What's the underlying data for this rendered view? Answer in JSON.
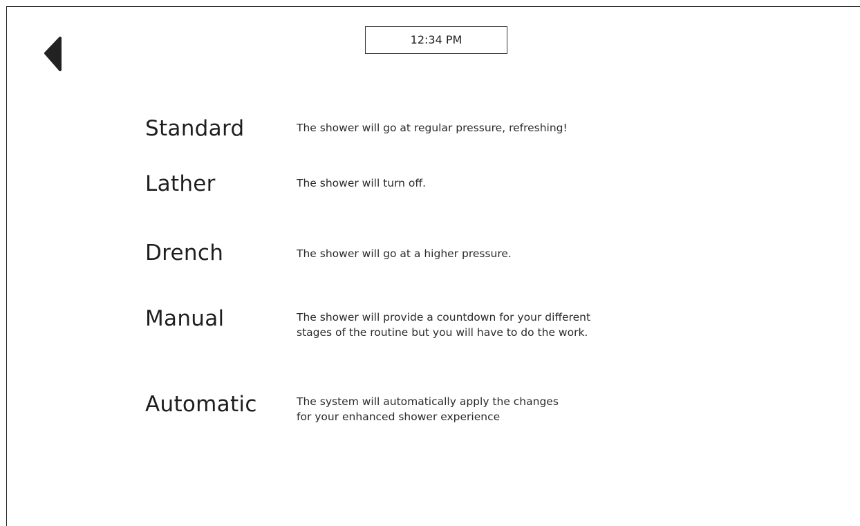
{
  "header": {
    "back_icon": "back-arrow-triangle",
    "time": "12:34 PM"
  },
  "modes": [
    {
      "name": "Standard",
      "description": "The shower will go at regular pressure, refreshing!"
    },
    {
      "name": "Lather",
      "description": "The shower will turn off."
    },
    {
      "name": "Drench",
      "description": "The shower will go at a higher pressure."
    },
    {
      "name": "Manual",
      "description": "The shower will provide a countdown for your different stages of the routine but you will have to do the work."
    },
    {
      "name": "Automatic",
      "description": "The system will automatically apply the changes for your enhanced shower experience"
    }
  ]
}
